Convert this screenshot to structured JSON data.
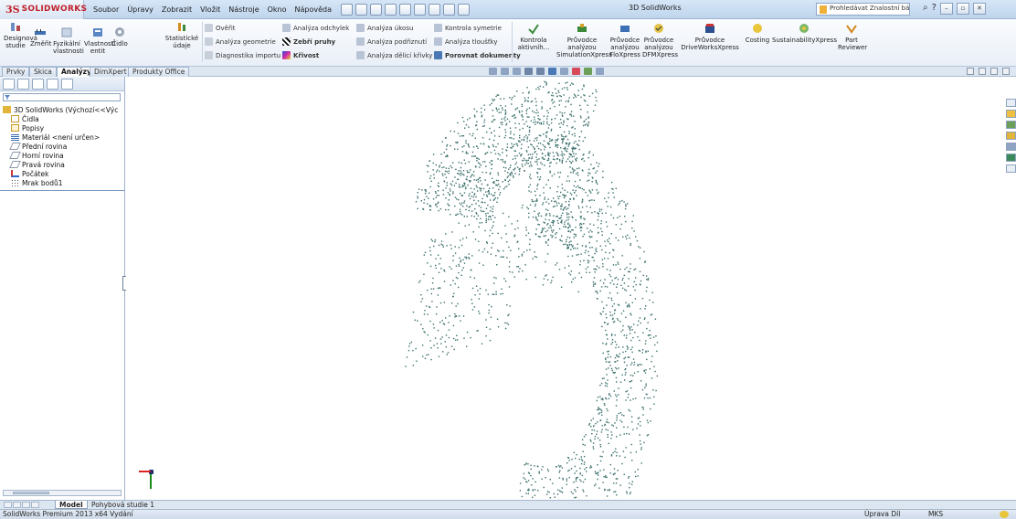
{
  "app": {
    "brand_mark": "3S",
    "brand_name": "SOLIDWORKS",
    "window_title": "3D SolidWorks"
  },
  "menu": [
    "Soubor",
    "Úpravy",
    "Zobrazit",
    "Vložit",
    "Nástroje",
    "Okno",
    "Nápověda"
  ],
  "knowledge_base": {
    "placeholder": "Prohledávat Znalostní báze"
  },
  "ribbon": {
    "large_buttons": [
      {
        "label": "Designová studie",
        "icon": "design-study-icon"
      },
      {
        "label": "Změřit",
        "icon": "measure-icon"
      },
      {
        "label": "Fyzikální vlastnosti",
        "icon": "mass-properties-icon"
      },
      {
        "label": "Vlastnosti entit",
        "icon": "entity-properties-icon"
      },
      {
        "label": "Čidlo",
        "icon": "sensor-icon"
      },
      {
        "label": "Statistické údaje",
        "icon": "statistics-icon"
      }
    ],
    "small_buttons": [
      {
        "label": "Ověřit",
        "icon": "check-icon"
      },
      {
        "label": "Analýza geometrie",
        "icon": "geometry-analysis-icon"
      },
      {
        "label": "Diagnostika importu",
        "icon": "import-diagnostics-icon"
      },
      {
        "label": "Analýza odchylek",
        "icon": "deviation-analysis-icon"
      },
      {
        "label": "Zebří pruhy",
        "icon": "zebra-stripes-icon"
      },
      {
        "label": "Křivost",
        "icon": "curvature-icon"
      },
      {
        "label": "Analýza úkosu",
        "icon": "draft-analysis-icon"
      },
      {
        "label": "Analýza podřiznutí",
        "icon": "undercut-analysis-icon"
      },
      {
        "label": "Analýza dělicí křivky",
        "icon": "parting-line-icon"
      },
      {
        "label": "Kontrola symetrie",
        "icon": "symmetry-check-icon"
      },
      {
        "label": "Analýza tloušťky",
        "icon": "thickness-analysis-icon"
      },
      {
        "label": "Porovnat dokumenty",
        "icon": "compare-documents-icon"
      }
    ],
    "right_buttons": [
      {
        "label": "Kontrola aktivníh...",
        "icon": "compliance-check-icon"
      },
      {
        "label": "Průvodce analýzou SimulationXpress",
        "icon": "simulationxpress-icon"
      },
      {
        "label": "Průvodce analýzou FloXpress",
        "icon": "floxpress-icon"
      },
      {
        "label": "Průvodce analýzou DFMXpress",
        "icon": "dfmxpress-icon"
      },
      {
        "label": "Průvodce DriveWorksXpress",
        "icon": "driveworksxpress-icon"
      },
      {
        "label": "Costing",
        "icon": "costing-icon"
      },
      {
        "label": "SustainabilityXpress",
        "icon": "sustainability-icon"
      },
      {
        "label": "Part Reviewer",
        "icon": "part-reviewer-icon"
      }
    ]
  },
  "command_tabs": [
    "Prvky",
    "Skica",
    "Analýzy",
    "DimXpert",
    "Produkty Office"
  ],
  "active_tab": "Analýzy",
  "feature_tree": {
    "root": "3D SolidWorks  (Výchozí<<Výc",
    "items": [
      "Čidla",
      "Popisy",
      "Materiál <není určen>",
      "Přední rovina",
      "Horní rovina",
      "Pravá rovina",
      "Počátek",
      "Mrak bodů1"
    ]
  },
  "bottom_tabs": [
    "Model",
    "Pohybová studie 1"
  ],
  "status": {
    "left": "SolidWorks Premium 2013 x64 Vydání",
    "mode": "Úprava Díl",
    "units": "MKS"
  },
  "colors": {
    "points": "#3a6f6c",
    "brand": "#c0202a",
    "accent": "#4a78b5"
  }
}
